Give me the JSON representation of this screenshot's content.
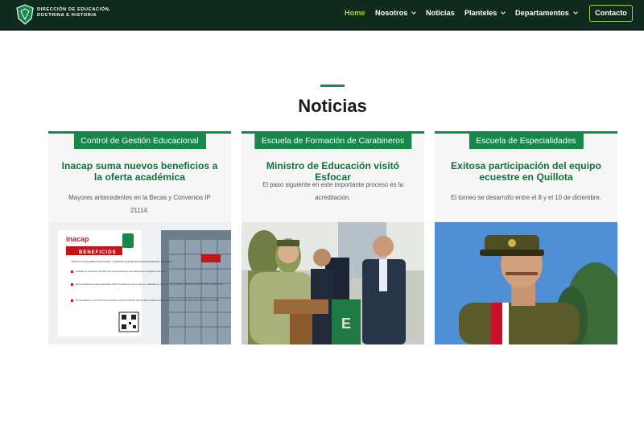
{
  "header": {
    "brand_line1": "DIRECCIÓN DE EDUCACIÓN,",
    "brand_line2": "DOCTRINA E HISTORIA",
    "nav": [
      {
        "label": "Home",
        "active": true
      },
      {
        "label": "Nosotros"
      },
      {
        "label": "Noticias"
      },
      {
        "label": "Planteles"
      },
      {
        "label": "Departamentos"
      }
    ],
    "contact_label": "Contacto"
  },
  "main": {
    "section_title": "Noticias",
    "cards": [
      {
        "category": "Control de Gestión Educacional",
        "title": "Inacap suma nuevos beneficios a la oferta académica",
        "description": "Mayores antecedentes en la Becas y Convenios IP 21114.",
        "image": {
          "logo_text": "inacap",
          "banner": "BENEFICIOS",
          "heading": "TODOS LOS ALUMNOS ANTIGUOS Y NUEVOS QUE SE MATRICULEN PARA EL AÑO 2024",
          "bullets": [
            "Tendrán un descuento del 30% que corresponderá a una rebaja de la colegiatura mensual.",
            "Excepcionalmente para la admisión 2024, los alumnos nuevos que se matriculen en el Centro de Formación Técnica tendrán un 30% de descuento.",
            "Al matricularse en el Centro de Formación Técnica INACAP más de 500 estudiantes con descuento del 30% sumarán automáticamente al 50%."
          ]
        }
      },
      {
        "category": "Escuela de Formación de Carabineros",
        "title": "Ministro de Educación visitó Esfocar",
        "description": "El paso siguiente en este importante proceso es la acreditación.",
        "image": {}
      },
      {
        "category": "Escuela de Especialidades",
        "title": "Exitosa participación del equipo ecuestre en Quillota",
        "description": "El torneo se desarrollo entre el 8 y el 10 de diciembre.",
        "image": {}
      }
    ]
  },
  "colors": {
    "nav_bg": "#0f2b1d",
    "accent_green": "#17874a",
    "title_green": "#13703d",
    "active_nav": "#a6d43b"
  }
}
